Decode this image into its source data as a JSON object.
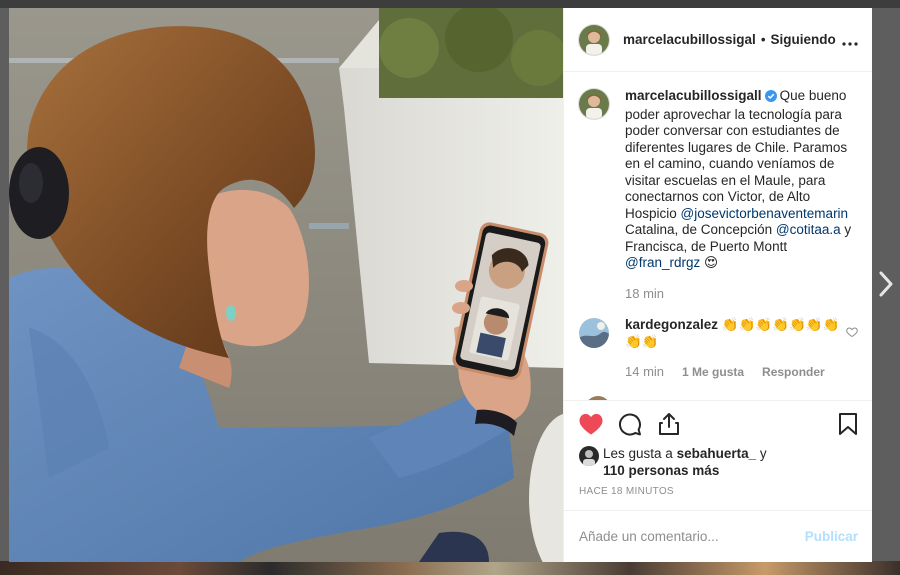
{
  "post": {
    "author": "marcelacubillossigal",
    "separator": "•",
    "follow_state": "Siguiendo",
    "caption": {
      "username": "marcelacubillossigall",
      "text_1": "Que bueno poder aprovechar la tecnología para poder conversar con estudiantes de diferentes lugares de Chile. Paramos en el camino, cuando veníamos de visitar escuelas en el Maule, para conectarnos con Victor, de Alto Hospicio ",
      "mention_1": "@josevictorbenaventemarin",
      "text_2": " Catalina, de Concepción ",
      "mention_2": "@cotitaa.a",
      "text_3": " y Francisca, de Puerto Montt ",
      "mention_3": "@fran_rdrgz",
      "emoji": "😍",
      "time": "18 min"
    },
    "comment": {
      "username": "kardegonzalez",
      "text": "👏👏👏👏👏👏👏👏👏",
      "time": "14 min",
      "likes": "1 Me gusta",
      "reply": "Responder"
    },
    "likes": {
      "prefix": "Les gusta a",
      "user": "sebahuerta_",
      "conj": "y",
      "others": "110 personas más"
    },
    "timestamp": "HACE 18 MINUTOS",
    "add_comment_placeholder": "Añade un comentario...",
    "publish_label": "Publicar"
  },
  "icons": {
    "more": "more-options-icon",
    "verified": "verified-badge-icon",
    "like": "heart-icon",
    "comment": "comment-bubble-icon",
    "share": "share-icon",
    "save": "bookmark-icon",
    "next": "chevron-right-icon"
  },
  "colors": {
    "liked_heart": "#ed4956",
    "verified": "#3897f0",
    "publish_disabled": "#b2dffc",
    "mention": "#00376b"
  }
}
